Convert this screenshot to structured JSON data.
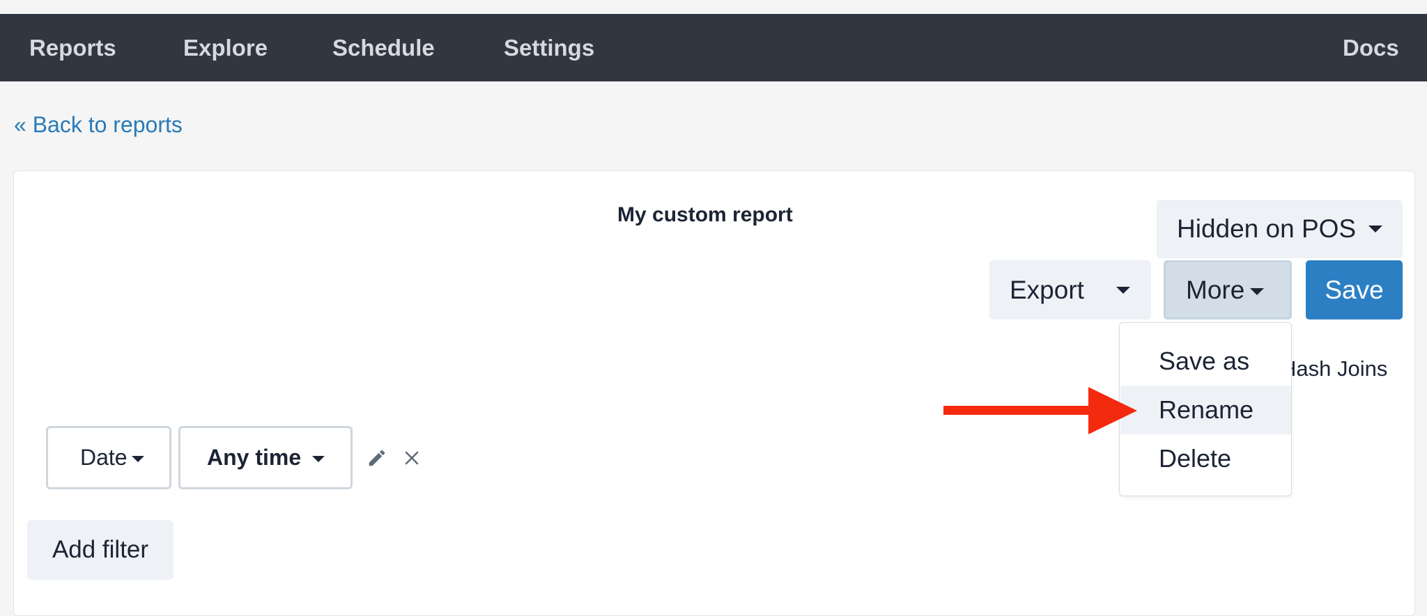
{
  "nav": {
    "items": [
      {
        "label": "Reports"
      },
      {
        "label": "Explore"
      },
      {
        "label": "Schedule"
      },
      {
        "label": "Settings"
      }
    ],
    "docs": "Docs"
  },
  "back_link": "« Back to reports",
  "report": {
    "title": "My custom report"
  },
  "toolbar": {
    "visibility": "Hidden on POS",
    "export": "Export",
    "more": "More",
    "save": "Save"
  },
  "partial_text": "Hash Joins",
  "more_menu": {
    "items": [
      {
        "label": "Save as"
      },
      {
        "label": "Rename"
      },
      {
        "label": "Delete"
      }
    ],
    "highlighted": "Rename"
  },
  "filters": [
    {
      "field": "Date",
      "value": "Any time"
    }
  ],
  "add_filter": "Add filter",
  "icons": {
    "edit": "pencil-icon",
    "remove": "close-icon",
    "pointer": "arrow-right-icon"
  },
  "colors": {
    "navbar": "#313640",
    "link": "#2a7ab8",
    "primary": "#2d7fc4",
    "annotation_arrow": "#f42a0f"
  }
}
